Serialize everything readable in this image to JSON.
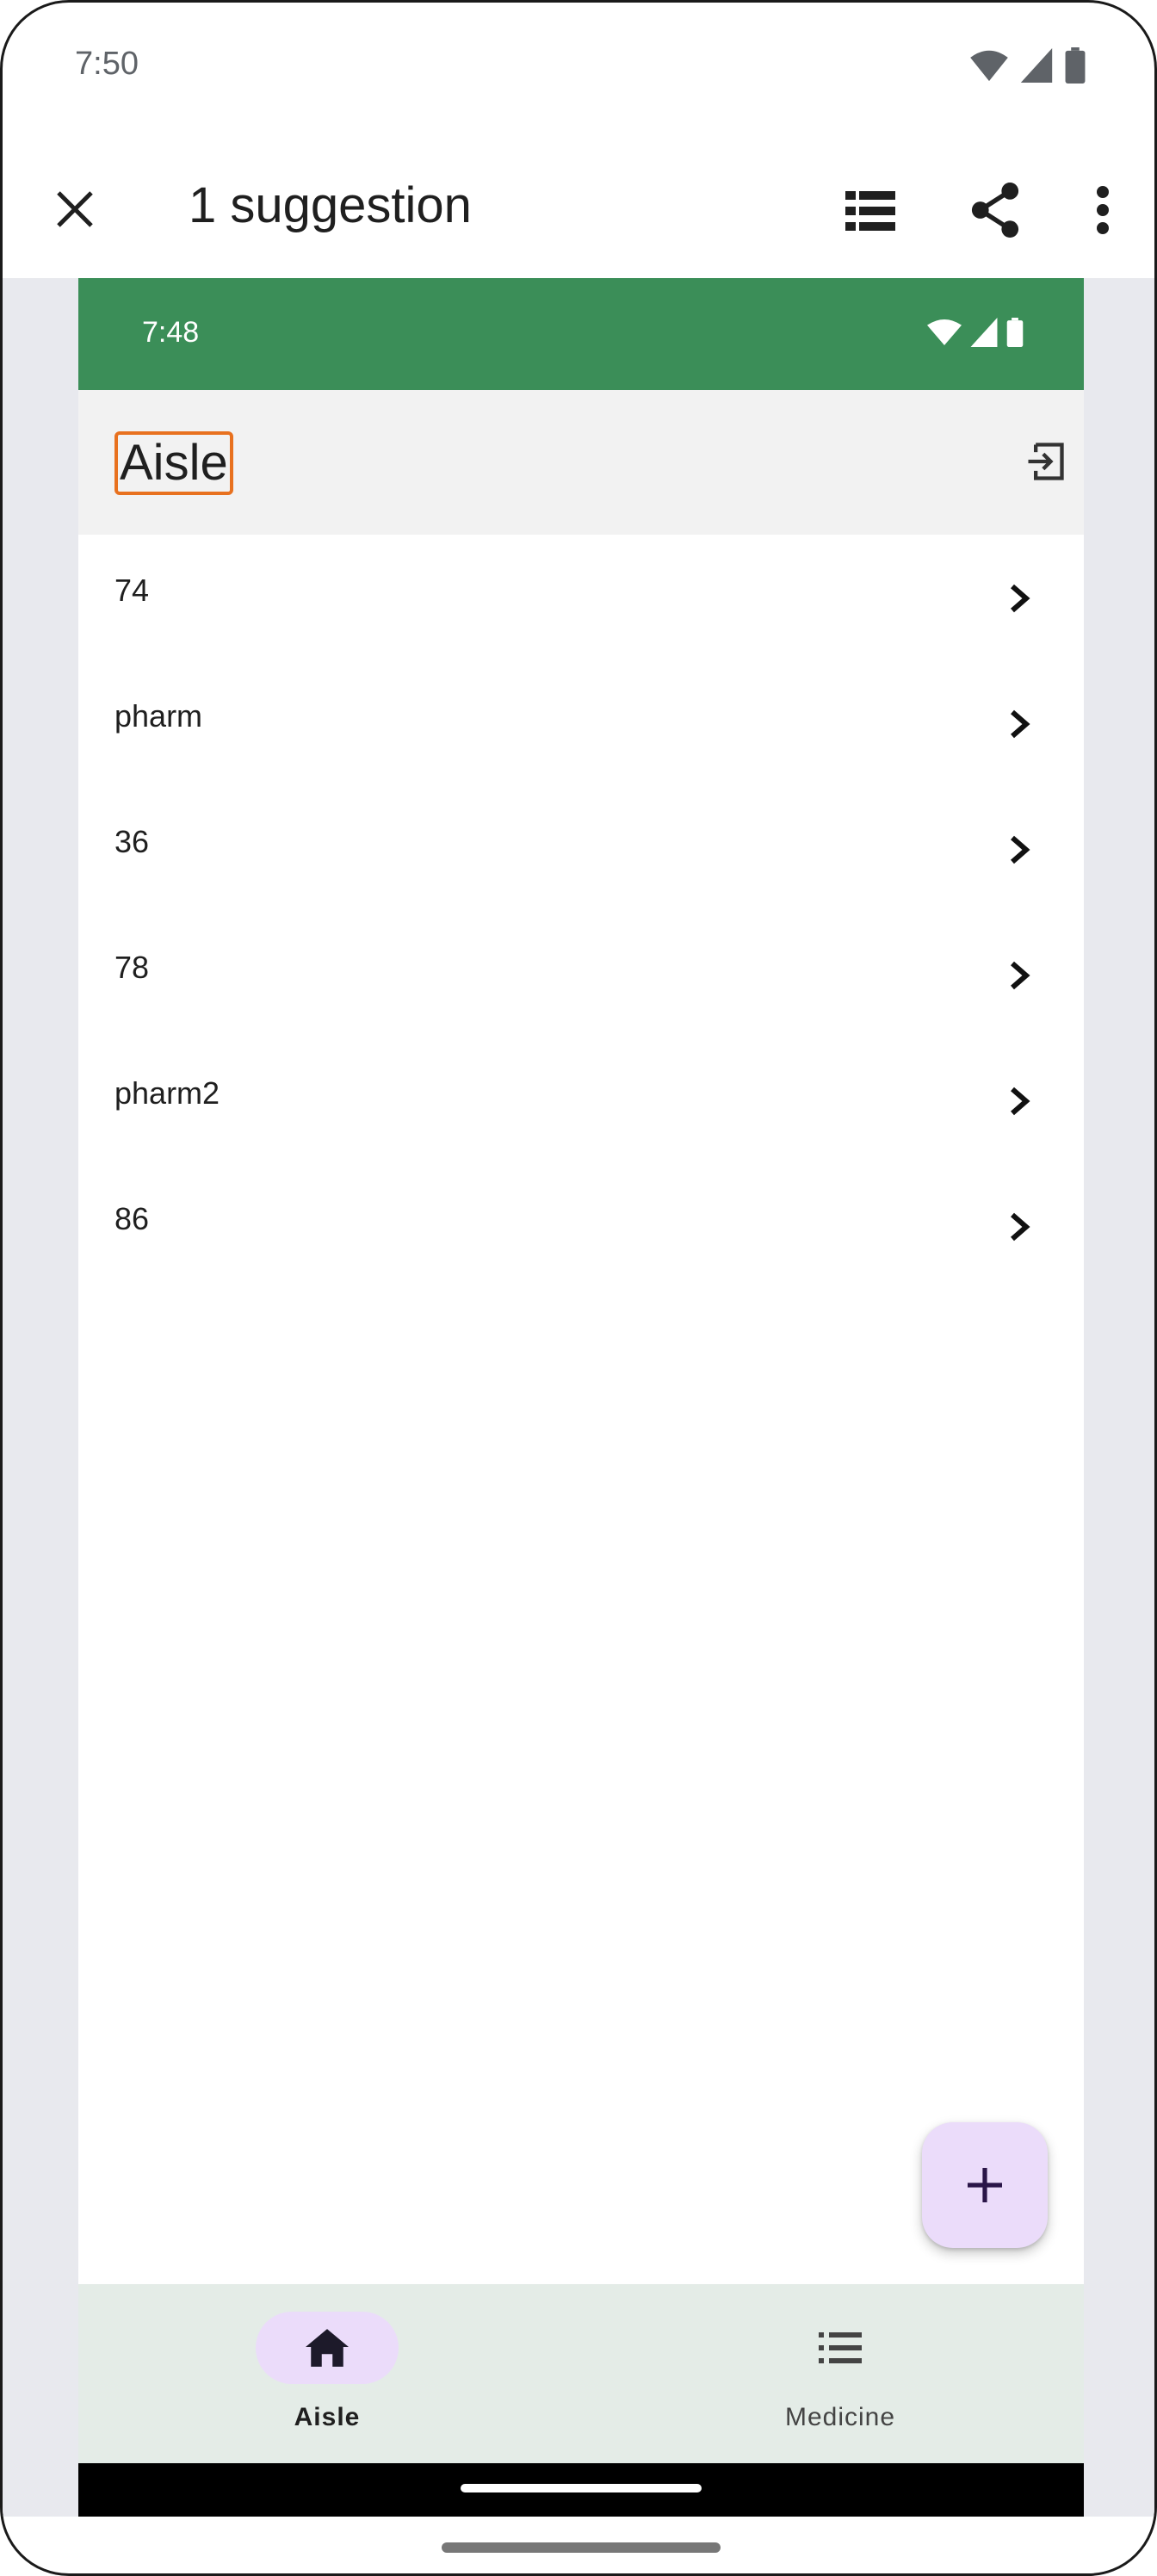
{
  "outer_status": {
    "time": "7:50"
  },
  "appbar": {
    "title": "1 suggestion"
  },
  "screenshot": {
    "status": {
      "time": "7:48"
    },
    "header": {
      "title": "Aisle"
    },
    "aisles": [
      {
        "label": "74"
      },
      {
        "label": "pharm"
      },
      {
        "label": "36"
      },
      {
        "label": "78"
      },
      {
        "label": "pharm2"
      },
      {
        "label": "86"
      }
    ],
    "bottom_nav": [
      {
        "label": "Aisle",
        "icon": "home-icon",
        "selected": true
      },
      {
        "label": "Medicine",
        "icon": "list-icon",
        "selected": false
      }
    ]
  },
  "colors": {
    "inner_status_bg": "#3b8e58",
    "highlight_border": "#e8711f",
    "fab_bg": "#ebdcfa",
    "nav_bg": "#e4ece7"
  }
}
